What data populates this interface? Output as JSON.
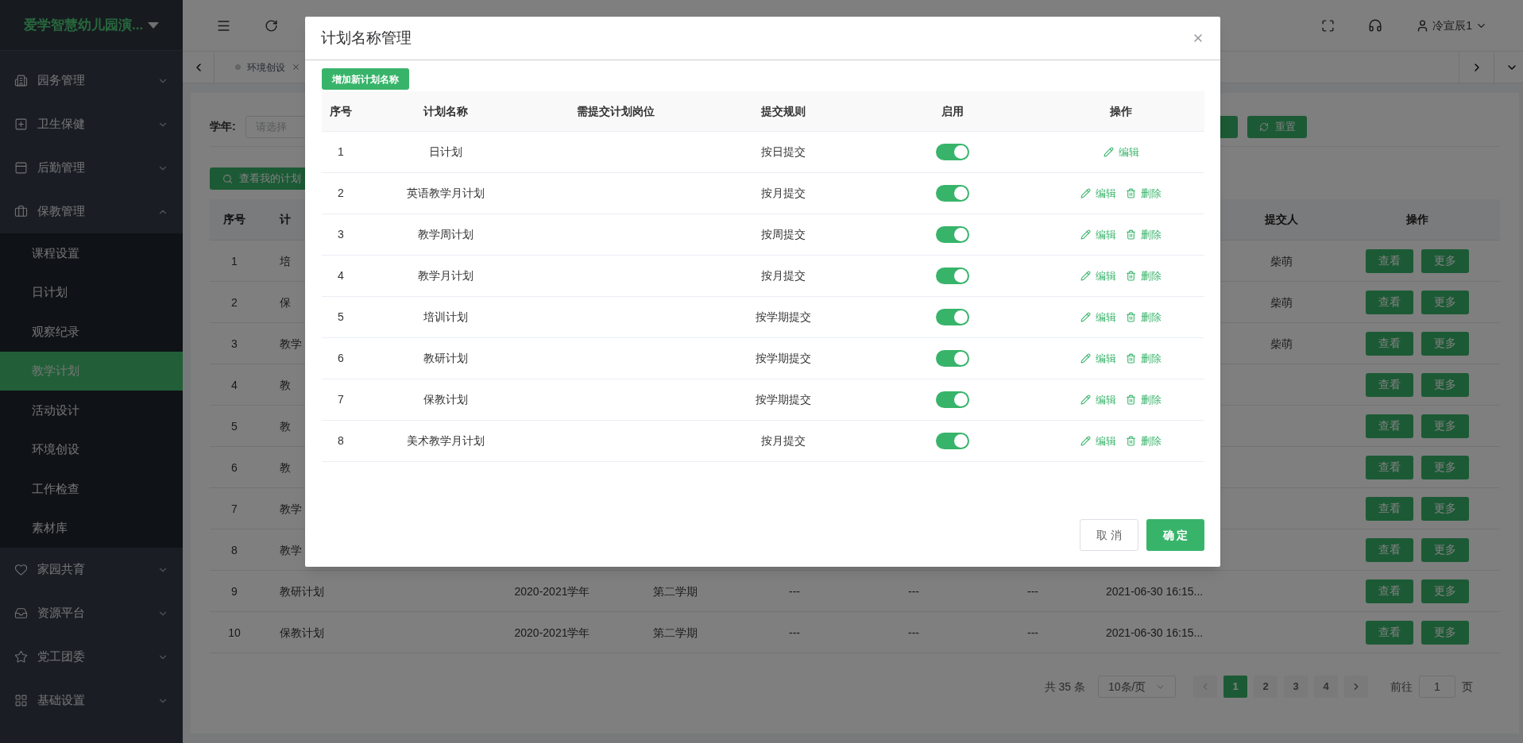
{
  "sidebar": {
    "logo": "爱学智慧幼儿园演...",
    "items": [
      {
        "label": "园务管理",
        "expanded": false
      },
      {
        "label": "卫生保健",
        "expanded": false
      },
      {
        "label": "后勤管理",
        "expanded": false
      },
      {
        "label": "保教管理",
        "expanded": true,
        "children": [
          {
            "label": "课程设置",
            "selected": false
          },
          {
            "label": "日计划",
            "selected": false
          },
          {
            "label": "观察纪录",
            "selected": false
          },
          {
            "label": "教学计划",
            "selected": true
          },
          {
            "label": "活动设计",
            "selected": false
          },
          {
            "label": "环境创设",
            "selected": false
          },
          {
            "label": "工作检查",
            "selected": false
          },
          {
            "label": "素材库",
            "selected": false
          }
        ]
      },
      {
        "label": "家园共育",
        "expanded": false
      },
      {
        "label": "资源平台",
        "expanded": false
      },
      {
        "label": "党工团委",
        "expanded": false
      },
      {
        "label": "基础设置",
        "expanded": false
      }
    ]
  },
  "topbar": {
    "user": "冷宣辰1"
  },
  "tabs": [
    {
      "label": "环境创设",
      "selected": false
    }
  ],
  "filter": {
    "label": "学年:",
    "placeholder": "请选择",
    "reset_button": "重置"
  },
  "my_plans_button": "查看我的计划",
  "table": {
    "header": {
      "index": "序号",
      "name": "计",
      "submitter": "提交人",
      "actions": "操作"
    },
    "rows": [
      {
        "index": "1",
        "name": "培",
        "submitter": "柴萌",
        "buttons": [
          "查看",
          "更多"
        ]
      },
      {
        "index": "2",
        "name": "保",
        "submitter": "柴萌",
        "buttons": [
          "查看",
          "更多"
        ]
      },
      {
        "index": "3",
        "name": "教学",
        "submitter": "柴萌",
        "buttons": [
          "查看",
          "更多"
        ]
      },
      {
        "index": "4",
        "name": "教",
        "buttons": [
          "查看",
          "更多"
        ]
      },
      {
        "index": "5",
        "name": "教",
        "buttons": [
          "查看",
          "更多"
        ]
      },
      {
        "index": "6",
        "name": "教",
        "buttons": [
          "查看",
          "更多"
        ]
      },
      {
        "index": "7",
        "name": "教学",
        "buttons": [
          "查看",
          "更多"
        ]
      },
      {
        "index": "8",
        "name": "教学",
        "buttons": [
          "查看",
          "更多"
        ]
      },
      {
        "index": "9",
        "name": "教研计划",
        "year": "2020-2021学年",
        "term": "第二学期",
        "column_5": "---",
        "column_6": "---",
        "column_7": "---",
        "time": "2021-06-30 16:15...",
        "buttons": [
          "查看",
          "更多"
        ]
      },
      {
        "index": "10",
        "name": "保教计划",
        "year": "2020-2021学年",
        "term": "第二学期",
        "column_5": "---",
        "column_6": "---",
        "column_7": "---",
        "time": "2021-06-30 16:15...",
        "buttons": [
          "查看",
          "更多"
        ]
      }
    ]
  },
  "pagination": {
    "total": "共 35 条",
    "page_size": "10条/页",
    "pages": [
      {
        "label": "1",
        "selected": true
      },
      {
        "label": "2",
        "selected": false
      },
      {
        "label": "3",
        "selected": false
      },
      {
        "label": "4",
        "selected": false
      }
    ],
    "goto_label": "前往",
    "goto_value": "1",
    "page_suffix": "页"
  },
  "modal": {
    "title": "计划名称管理",
    "add_button": "增加新计划名称",
    "columns": [
      "序号",
      "计划名称",
      "需提交计划岗位",
      "提交规则",
      "启用",
      "操作"
    ],
    "rows": [
      {
        "index": "1",
        "name": "日计划",
        "rule": "按日提交",
        "enabled": true,
        "actions": [
          {
            "kind": "edit",
            "label": "编辑"
          }
        ]
      },
      {
        "index": "2",
        "name": "英语教学月计划",
        "rule": "按月提交",
        "enabled": true,
        "actions": [
          {
            "kind": "edit",
            "label": "编辑"
          },
          {
            "kind": "delete",
            "label": "删除"
          }
        ]
      },
      {
        "index": "3",
        "name": "教学周计划",
        "rule": "按周提交",
        "enabled": true,
        "actions": [
          {
            "kind": "edit",
            "label": "编辑"
          },
          {
            "kind": "delete",
            "label": "删除"
          }
        ]
      },
      {
        "index": "4",
        "name": "教学月计划",
        "rule": "按月提交",
        "enabled": true,
        "actions": [
          {
            "kind": "edit",
            "label": "编辑"
          },
          {
            "kind": "delete",
            "label": "删除"
          }
        ]
      },
      {
        "index": "5",
        "name": "培训计划",
        "rule": "按学期提交",
        "enabled": true,
        "actions": [
          {
            "kind": "edit",
            "label": "编辑"
          },
          {
            "kind": "delete",
            "label": "删除"
          }
        ]
      },
      {
        "index": "6",
        "name": "教研计划",
        "rule": "按学期提交",
        "enabled": true,
        "actions": [
          {
            "kind": "edit",
            "label": "编辑"
          },
          {
            "kind": "delete",
            "label": "删除"
          }
        ]
      },
      {
        "index": "7",
        "name": "保教计划",
        "rule": "按学期提交",
        "enabled": true,
        "actions": [
          {
            "kind": "edit",
            "label": "编辑"
          },
          {
            "kind": "delete",
            "label": "删除"
          }
        ]
      },
      {
        "index": "8",
        "name": "美术教学月计划",
        "rule": "按月提交",
        "enabled": true,
        "actions": [
          {
            "kind": "edit",
            "label": "编辑"
          },
          {
            "kind": "delete",
            "label": "删除"
          }
        ]
      }
    ],
    "cancel_button": "取 消",
    "confirm_button": "确 定"
  }
}
